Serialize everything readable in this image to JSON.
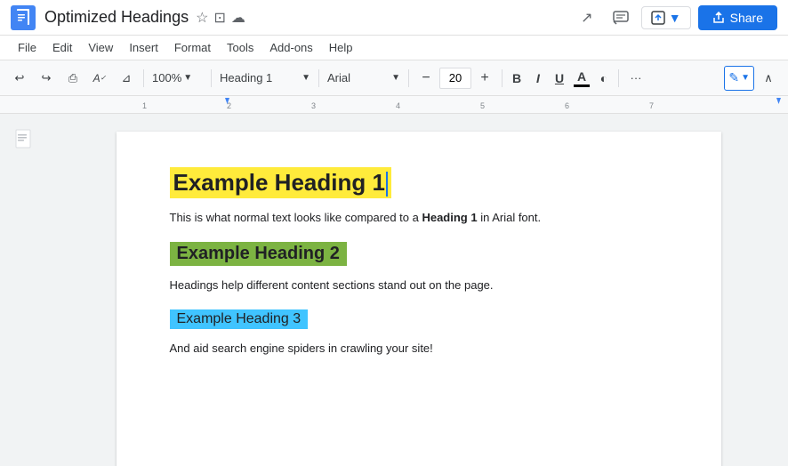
{
  "titleBar": {
    "appIcon": "≡",
    "docTitle": "Optimized Headings",
    "starIcon": "☆",
    "moveToIcon": "⊡",
    "cloudIcon": "☁",
    "chartIcon": "↗",
    "commentIcon": "☰",
    "moveToLabel": "⊡",
    "shareLabel": "Share"
  },
  "menuBar": {
    "items": [
      "File",
      "Edit",
      "View",
      "Insert",
      "Format",
      "Tools",
      "Add-ons",
      "Help"
    ]
  },
  "toolbar": {
    "undoLabel": "↩",
    "redoLabel": "↪",
    "printLabel": "⎙",
    "paintFormatLabel": "✎",
    "copyFormatLabel": "⊿",
    "zoomLevel": "100%",
    "headingStyle": "Heading 1",
    "fontFamily": "Arial",
    "fontSize": "20",
    "boldLabel": "B",
    "italicLabel": "I",
    "underlineLabel": "U",
    "colorLabel": "A",
    "highlightLabel": "◐",
    "moreLabel": "···",
    "editLabel": "✎"
  },
  "document": {
    "heading1": "Example Heading 1",
    "bodyText1": "This is what normal text looks like compared to a ",
    "bodyText1Bold": "Heading 1",
    "bodyText1End": " in Arial font.",
    "heading2": "Example Heading 2",
    "bodyText2": "Headings help different content sections stand out on the page.",
    "heading3": "Example Heading 3",
    "bodyText3": "And aid search engine spiders in crawling your site!"
  },
  "ruler": {
    "marks": [
      "1",
      "2",
      "3",
      "4",
      "5",
      "6",
      "7"
    ]
  }
}
